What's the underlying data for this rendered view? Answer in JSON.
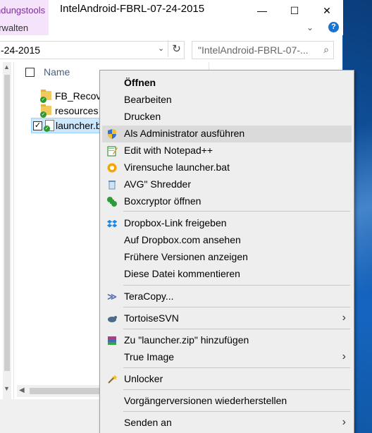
{
  "window": {
    "context_tab_top": "ndungstools",
    "context_tab_ribbon": "erwalten",
    "title": "IntelAndroid-FBRL-07-24-2015",
    "minimize": "—",
    "maximize": "☐",
    "close": "✕",
    "help": "?"
  },
  "address": {
    "path": "-24-2015",
    "dropdown": "⌄",
    "refresh": "↻"
  },
  "search": {
    "placeholder": "\"IntelAndroid-FBRL-07-...",
    "icon": "⌕"
  },
  "columns": {
    "name": "Name"
  },
  "files": [
    {
      "name": "FB_Recov",
      "type": "folder"
    },
    {
      "name": "resources",
      "type": "folder"
    },
    {
      "name": "launcher.b",
      "type": "file",
      "selected": true
    }
  ],
  "menu": {
    "items": [
      {
        "label": "Öffnen"
      },
      {
        "label": "Bearbeiten"
      },
      {
        "label": "Drucken"
      },
      {
        "label": "Als Administrator ausführen",
        "icon": "shield-icon"
      },
      {
        "label": "Edit with Notepad++",
        "icon": "notepad-icon"
      },
      {
        "label": "Virensuche launcher.bat",
        "icon": "antivirus-icon"
      },
      {
        "label": "AVG\" Shredder",
        "icon": "shredder-icon"
      },
      {
        "label": "Boxcryptor öffnen",
        "icon": "boxcryptor-icon"
      },
      {
        "label": "Dropbox-Link freigeben",
        "icon": "dropbox-icon"
      },
      {
        "label": "Auf Dropbox.com ansehen"
      },
      {
        "label": "Frühere Versionen anzeigen"
      },
      {
        "label": "Diese Datei kommentieren"
      },
      {
        "label": "TeraCopy...",
        "icon": "teracopy-icon"
      },
      {
        "label": "TortoiseSVN",
        "icon": "tortoise-icon",
        "submenu": true
      },
      {
        "label": "Zu \"launcher.zip\" hinzufügen",
        "icon": "archive-icon"
      },
      {
        "label": "True Image",
        "submenu": true
      },
      {
        "label": "Unlocker",
        "icon": "wand-icon"
      },
      {
        "label": "Vorgängerversionen wiederherstellen"
      },
      {
        "label": "Senden an",
        "submenu": true
      }
    ],
    "hovered": "Als Administrator ausführen",
    "submenu_arrow": "›"
  },
  "colors": {
    "context_tab_bg": "#f4e3fb",
    "selection_bg": "#cce8ff",
    "menu_bg": "#eeeeee",
    "menu_hover": "#dadada",
    "desktop": "#1565c0"
  }
}
